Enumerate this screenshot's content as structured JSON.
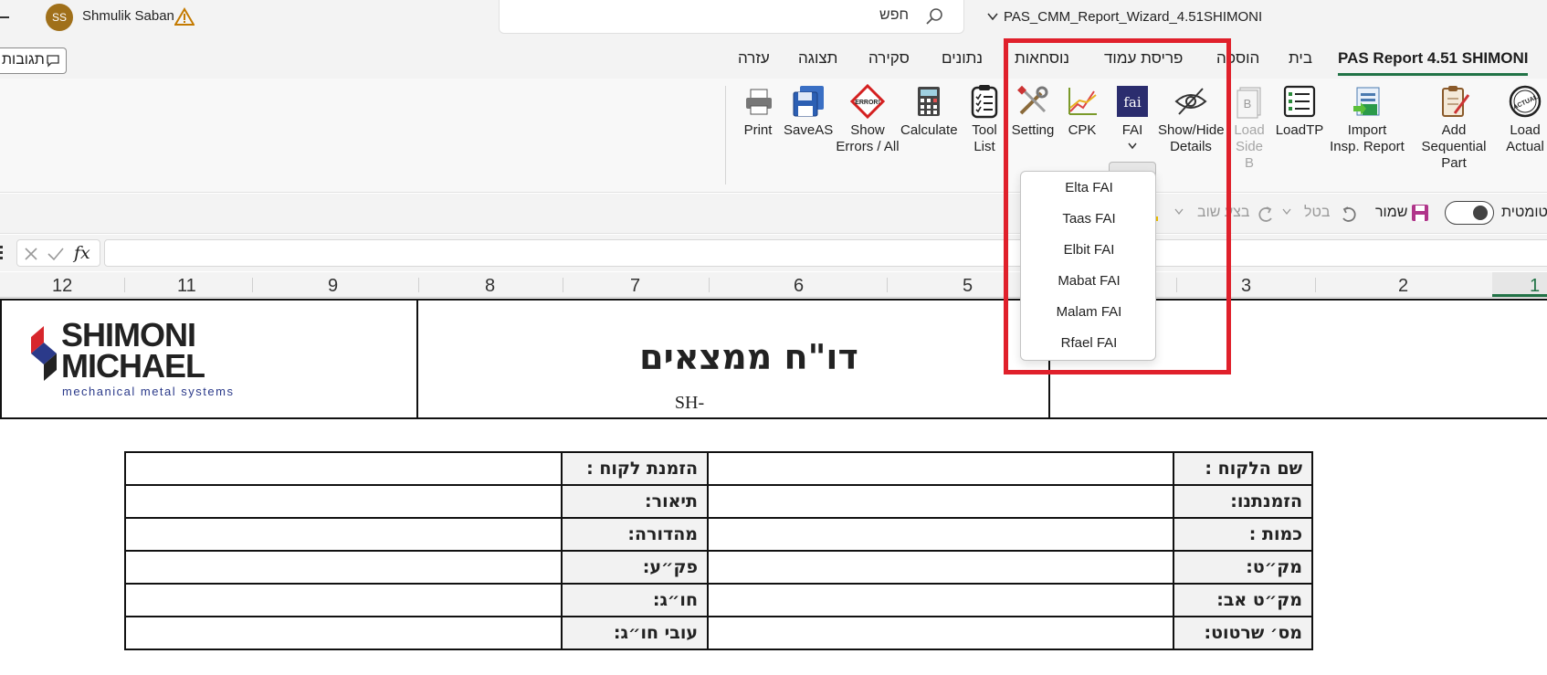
{
  "titlebar": {
    "user_initials": "SS",
    "user_name": "Shmulik Saban",
    "warning_icon": "warning-icon",
    "search_placeholder": "חפש",
    "file_name": "PAS_CMM_Report_Wizard_4.51SHIMONI",
    "comments_label": "תגובות"
  },
  "tabs": [
    {
      "label": "PAS Report 4.51 SHIMONI",
      "active": true
    },
    {
      "label": "בית"
    },
    {
      "label": "הוספה"
    },
    {
      "label": "פריסת עמוד"
    },
    {
      "label": "נוסחאות"
    },
    {
      "label": "נתונים"
    },
    {
      "label": "סקירה"
    },
    {
      "label": "תצוגה"
    },
    {
      "label": "עזרה"
    }
  ],
  "ribbon": {
    "print": "Print",
    "saveas": "SaveAS",
    "show_errors_1": "Show",
    "show_errors_2": "Errors / All",
    "calculate": "Calculate",
    "tool_list_1": "Tool",
    "tool_list_2": "List",
    "setting": "Setting",
    "cpk": "CPK",
    "fai": "FAI",
    "fai_icon_text": "fai",
    "show_hide_1": "Show/Hide",
    "show_hide_2": "Details",
    "load_side_b_1": "Load",
    "load_side_b_2": "Side B",
    "loadtp": "LoadTP",
    "import_1": "Import",
    "import_2": "Insp. Report",
    "add_seq_1": "Add Sequential",
    "add_seq_2": "Part",
    "load_actual_1": "Load",
    "load_actual_2": "Actual",
    "error_icon_text": "ERROR!",
    "actual_icon_text": "ACTUAL"
  },
  "fai_menu": [
    "Elta FAI",
    "Taas FAI",
    "Elbit FAI",
    "Mabat FAI",
    "Malam FAI",
    "Rfael FAI"
  ],
  "qat": {
    "autosave": "טומטית",
    "save": "שמור",
    "undo": "בטל",
    "redo": "בצע שוב"
  },
  "formula_bar": {
    "fx": "fx",
    "value": ""
  },
  "columns": [
    "12",
    "11",
    "9",
    "8",
    "7",
    "6",
    "5",
    "3",
    "2",
    "1"
  ],
  "sheet": {
    "logo_line1": "SHIMONI",
    "logo_line2": "MICHAEL",
    "logo_tagline": "mechanical metal systems",
    "report_title": "דו\"ח ממצאים",
    "report_number": "SH-"
  },
  "form_rows": [
    {
      "right_label": "שם הלקוח :",
      "right_value": "",
      "left_label": "הזמנת לקוח :",
      "left_value": ""
    },
    {
      "right_label": "הזמנתנו:",
      "right_value": "",
      "left_label": "תיאור:",
      "left_value": ""
    },
    {
      "right_label": "כמות :",
      "right_value": "",
      "left_label": "מהדורה:",
      "left_value": ""
    },
    {
      "right_label": "מק״ט:",
      "right_value": "",
      "left_label": "פק״ע:",
      "left_value": ""
    },
    {
      "right_label": "מק״ט אב:",
      "right_value": "",
      "left_label": "חו״ג:",
      "left_value": ""
    },
    {
      "right_label": "מס׳ שרטוט:",
      "right_value": "",
      "left_label": "עובי חו״ג:",
      "left_value": ""
    }
  ],
  "colors": {
    "accent": "#217346",
    "highlight": "#e0202b",
    "fai_icon": "#2b2d6e"
  }
}
